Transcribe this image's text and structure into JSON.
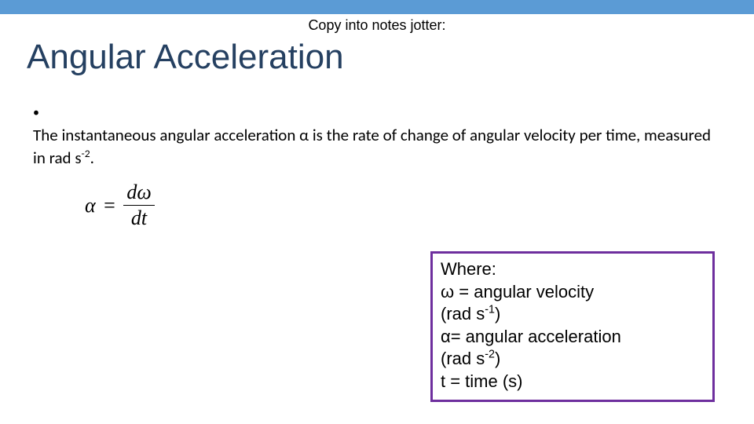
{
  "top_note": "Copy into notes jotter:",
  "title": "Angular Acceleration",
  "bullet": {
    "pre": "The instantaneous angular acceleration α is the rate of change of angular velocity per time, measured in rad s",
    "sup": "-2",
    "post": "."
  },
  "formula": {
    "lhs": "α",
    "eq": "=",
    "num": "dω",
    "den": "dt"
  },
  "legend": {
    "where": "Where:",
    "line1a": "ω = angular velocity",
    "line1b_pre": "(rad s",
    "line1b_sup": "-1",
    "line1b_post": ")",
    "line2a": "α= angular acceleration",
    "line2b_pre": "(rad s",
    "line2b_sup": "-2",
    "line2b_post": ")",
    "line3": "t = time (s)"
  }
}
